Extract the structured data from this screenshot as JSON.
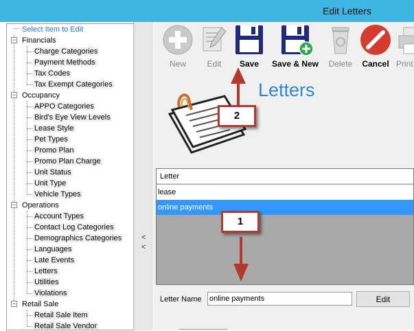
{
  "window": {
    "title": "Edit Letters"
  },
  "tree": {
    "root_label": "Select Item to Edit",
    "groups": [
      {
        "label": "Financials",
        "items": [
          "Charge Categories",
          "Payment Methods",
          "Tax Codes",
          "Tax Exempt Categories"
        ]
      },
      {
        "label": "Occupancy",
        "items": [
          "APPO Categories",
          "Bird's Eye View Levels",
          "Lease Style",
          "Pet Types",
          "Promo Plan",
          "Promo Plan Charge",
          "Unit Status",
          "Unit Type",
          "Vehicle Types"
        ]
      },
      {
        "label": "Operations",
        "items": [
          "Account Types",
          "Contact Log Categories",
          "Demographics Categories",
          "Languages",
          "Late Events",
          "Letters",
          "Utilities",
          "Violations"
        ]
      },
      {
        "label": "Retail Sale",
        "items": [
          "Retail Sale Item",
          "Retail Sale Vendor"
        ]
      }
    ]
  },
  "splitter": {
    "collapse_glyph": "<<"
  },
  "toolbar": {
    "new": "New",
    "edit": "Edit",
    "save": "Save",
    "save_new": "Save & New",
    "delete": "Delete",
    "cancel": "Cancel",
    "print": "Print"
  },
  "heading": "Letters",
  "grid": {
    "column": "Letter",
    "rows": [
      "lease",
      "online payments"
    ],
    "selected_row": 1
  },
  "form": {
    "name_label": "Letter Name",
    "name_value": "online payments",
    "edit_button": "Edit"
  },
  "annotations": {
    "callout_1": "1",
    "callout_2": "2"
  },
  "colors": {
    "titlebar": "#3fb5e3",
    "selection": "#3399ff",
    "heading": "#2f86d8",
    "tree_selected": "#2a73d9",
    "annotation_red": "#b13a2d",
    "save_blue": "#1f2a7a",
    "cancel_red": "#d63b30",
    "new_green": "#2aa84a"
  }
}
